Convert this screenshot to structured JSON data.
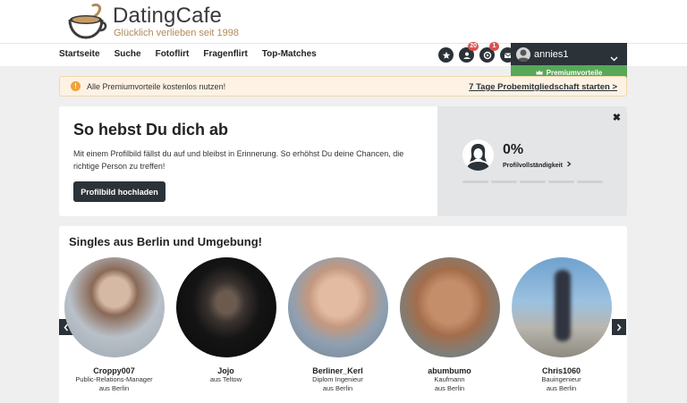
{
  "brand": {
    "name": "DatingCafe",
    "tagline": "Glücklich verlieben seit 1998"
  },
  "nav": {
    "items": [
      "Startseite",
      "Suche",
      "Fotoflirt",
      "Fragenflirt",
      "Top-Matches"
    ]
  },
  "header_icons": {
    "favorites": "star-icon",
    "visitors_badge": "20",
    "messages_badge": "1"
  },
  "user": {
    "name": "annies1",
    "premium_label": "Premiumvorteile"
  },
  "alert": {
    "text": "Alle Premiumvorteile kostenlos nutzen!",
    "link": "7 Tage Probemitgliedschaft starten"
  },
  "profile_card": {
    "title": "So hebst Du dich ab",
    "text": "Mit einem Profilbild fällst du auf und bleibst in Erinnerung. So erhöhst Du deine Chancen, die richtige Person zu treffen!",
    "button": "Profilbild hochladen",
    "completion": "0%",
    "completion_label": "Profilvollständigkeit"
  },
  "singles": {
    "title": "Singles aus Berlin und Umgebung!",
    "profiles": [
      {
        "name": "Croppy007",
        "line1": "Public-Relations-Manager",
        "line2": "aus Berlin"
      },
      {
        "name": "Jojo",
        "line1": "aus Teltow",
        "line2": ""
      },
      {
        "name": "Berliner_Kerl",
        "line1": "Diplom Ingenieur",
        "line2": "aus Berlin"
      },
      {
        "name": "abumbumo",
        "line1": "Kaufmann",
        "line2": "aus Berlin"
      },
      {
        "name": "Chris1060",
        "line1": "Bauingenieur",
        "line2": "aus Berlin"
      }
    ]
  },
  "colors": {
    "dark": "#2b3238",
    "premium_green": "#57a857",
    "alert_bg": "#fdf2e3",
    "badge_red": "#d9534f"
  }
}
